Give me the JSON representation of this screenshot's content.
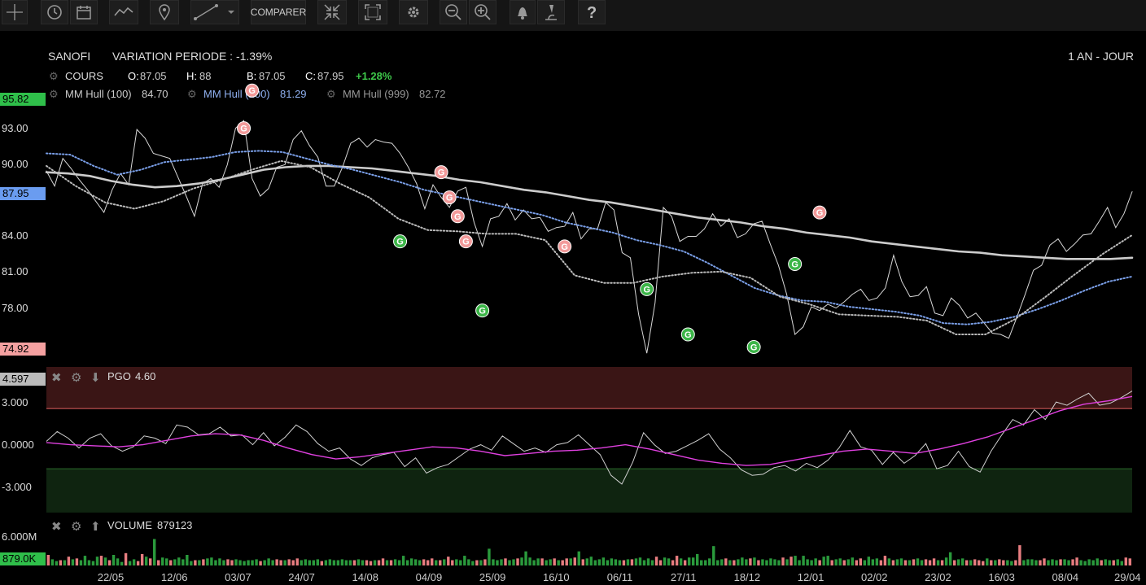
{
  "toolbar": {
    "compare_label": "COMPARER"
  },
  "header": {
    "symbol": "SANOFI",
    "variation_label": "VARIATION PERIODE : -1.39%",
    "period": "1 AN - JOUR"
  },
  "legend": {
    "cours_label": "COURS",
    "o_label": "O:",
    "o_value": "87.05",
    "h_label": "H:",
    "h_value": "88",
    "b_label": "B:",
    "b_value": "87.05",
    "c_label": "C:",
    "c_value": "87.95",
    "change": "+1.28%",
    "hull100": "MM Hull (100)",
    "hull100_value": "84.70",
    "hull200": "MM Hull (200)",
    "hull200_value": "81.29",
    "hull999": "MM Hull (999)",
    "hull999_value": "82.72"
  },
  "pgo_panel": {
    "label": "PGO",
    "value": "4.60",
    "badge": "4.597"
  },
  "volume_panel": {
    "label": "VOLUME",
    "value": "879123",
    "badge": "879.0K",
    "top_tick": "6.000M"
  },
  "price_badges": {
    "high": "95.82",
    "current": "87.95",
    "low": "74.92"
  },
  "colors": {
    "up": "#2db84b",
    "down": "#f08080",
    "hull100": "#cccccc",
    "hull200": "#7a9fe8",
    "hull999": "#999999",
    "pgo_signal": "#e040e0",
    "change": "#3ec94a"
  },
  "chart_data": [
    {
      "type": "line",
      "series": [
        {
          "name": "COURS",
          "values": [
            89.6,
            88.4,
            90.6,
            89.8,
            88.9,
            88.1,
            87.2,
            86.3,
            88.1,
            89.4,
            88.5,
            92.9,
            92.2,
            91.0,
            90.8,
            90.6,
            89.1,
            87.6,
            86.0,
            88.6,
            89.0,
            88.3,
            90.1,
            93.0,
            93.6,
            89.0,
            87.6,
            88.2,
            89.9,
            90.1,
            92.1,
            92.8,
            91.6,
            90.7,
            88.4,
            88.4,
            89.9,
            91.8,
            92.2,
            91.5,
            92.1,
            91.9,
            91.8,
            91.0,
            89.9,
            88.6,
            86.6,
            88.5,
            87.5,
            86.7,
            88.0,
            88.3,
            85.5,
            83.6,
            85.8,
            86.0,
            87.0,
            85.7,
            86.5,
            85.8,
            85.9,
            84.8,
            85.1,
            85.2,
            86.3,
            84.2,
            85.0,
            85.0,
            87.1,
            86.5,
            83.1,
            82.7,
            78.2,
            75.1,
            79.1,
            86.7,
            86.0,
            84.0,
            84.4,
            84.4,
            85.0,
            86.2,
            85.2,
            85.8,
            84.3,
            84.6,
            85.4,
            85.6,
            83.8,
            82.1,
            79.8,
            76.6,
            77.2,
            78.8,
            78.5,
            79.0,
            78.7,
            79.2,
            79.8,
            80.2,
            79.3,
            79.5,
            80.3,
            82.9,
            80.8,
            79.6,
            79.7,
            80.4,
            78.3,
            78.1,
            79.5,
            78.9,
            77.9,
            78.3,
            77.5,
            76.7,
            76.6,
            76.3,
            78.0,
            79.8,
            81.7,
            82.1,
            83.7,
            84.2,
            83.2,
            83.8,
            84.5,
            84.6,
            85.6,
            86.7,
            85.1,
            86.2,
            87.95
          ]
        },
        {
          "name": "MM Hull (100)",
          "values": [
            89.5,
            89.4,
            89.2,
            88.8,
            88.5,
            88.3,
            88.4,
            88.6,
            88.9,
            89.3,
            89.7,
            89.9,
            90.0,
            90.0,
            89.9,
            89.8,
            89.6,
            89.4,
            89.2,
            88.9,
            88.7,
            88.4,
            88.1,
            87.9,
            87.6,
            87.3,
            87.1,
            86.8,
            86.5,
            86.2,
            85.9,
            85.7,
            85.5,
            85.2,
            85.0,
            84.7,
            84.5,
            84.3,
            84.0,
            83.8,
            83.6,
            83.4,
            83.2,
            83.1,
            82.9,
            82.8,
            82.7,
            82.6,
            82.6,
            82.6,
            82.7
          ]
        },
        {
          "name": "MM Hull (200)",
          "values": [
            91.0,
            90.9,
            90.0,
            89.3,
            89.7,
            90.3,
            90.5,
            90.7,
            91.1,
            91.2,
            91.1,
            90.6,
            90.1,
            89.7,
            89.2,
            88.7,
            88.1,
            87.7,
            87.3,
            86.9,
            86.5,
            86.1,
            85.5,
            85.1,
            84.7,
            84.1,
            83.7,
            83.2,
            82.3,
            81.3,
            80.3,
            79.7,
            79.3,
            79.2,
            78.8,
            78.6,
            78.4,
            78.1,
            77.5,
            77.4,
            77.6,
            78.0,
            78.6,
            79.3,
            80.1,
            80.8,
            81.2
          ]
        },
        {
          "name": "MM Hull (999)",
          "values": [
            90.0,
            88.4,
            87.1,
            86.6,
            87.2,
            88.2,
            88.9,
            89.7,
            90.4,
            89.9,
            88.6,
            87.5,
            85.8,
            84.9,
            84.8,
            84.6,
            84.6,
            84.1,
            81.3,
            80.7,
            80.7,
            81.2,
            81.5,
            81.6,
            81.1,
            79.6,
            79.0,
            78.2,
            78.1,
            78.0,
            77.7,
            76.6,
            76.6,
            77.8,
            79.5,
            81.3,
            83.0,
            84.5
          ]
        }
      ],
      "ylim": [
        74.92,
        95.82
      ],
      "y_ticks": [
        "93.00",
        "90.00",
        "84.00",
        "81.00",
        "78.00"
      ]
    },
    {
      "type": "line",
      "series": [
        {
          "name": "PGO",
          "values": [
            0.0,
            0.9,
            0.3,
            -0.6,
            0.3,
            0.7,
            -0.4,
            -0.9,
            -0.5,
            0.5,
            0.3,
            -0.2,
            1.5,
            1.3,
            0.6,
            0.7,
            1.3,
            0.5,
            0.6,
            -0.3,
            0.8,
            -0.4,
            0.4,
            1.5,
            0.9,
            -0.2,
            -0.9,
            -0.6,
            -1.6,
            -2.2,
            -1.5,
            -1.2,
            -1.0,
            -2.3,
            -1.5,
            -2.9,
            -2.4,
            -2.1,
            -1.4,
            -0.7,
            -0.3,
            -0.8,
            0.5,
            -0.2,
            -0.9,
            -0.6,
            -1.0,
            -0.3,
            -0.1,
            0.6,
            -0.3,
            -1.2,
            -3.1,
            -3.9,
            -1.9,
            0.8,
            -0.3,
            -1.1,
            -0.9,
            -0.4,
            0.1,
            0.7,
            -0.7,
            -1.5,
            -2.6,
            -3.1,
            -3.0,
            -2.4,
            -2.2,
            -2.7,
            -2.0,
            -2.4,
            -1.7,
            -0.6,
            1.0,
            -0.5,
            -0.8,
            -2.1,
            -1.0,
            -2.0,
            -1.3,
            -0.2,
            -2.5,
            -2.2,
            -0.9,
            -2.3,
            -2.8,
            -0.9,
            0.6,
            2.0,
            1.5,
            2.9,
            2.0,
            3.6,
            3.3,
            3.9,
            4.4,
            3.3,
            3.5,
            4.0,
            4.6
          ]
        },
        {
          "name": "Signal",
          "values": [
            -0.1,
            -0.3,
            -0.4,
            -0.5,
            -0.3,
            0.1,
            0.5,
            0.7,
            0.6,
            0.1,
            -0.6,
            -1.2,
            -1.6,
            -1.4,
            -1.1,
            -0.8,
            -0.5,
            -0.6,
            -0.9,
            -1.3,
            -1.1,
            -0.9,
            -0.8,
            -0.6,
            -0.3,
            -0.7,
            -1.2,
            -1.7,
            -2.0,
            -2.2,
            -2.1,
            -1.7,
            -1.3,
            -0.9,
            -0.7,
            -0.9,
            -1.1,
            -0.7,
            -0.2,
            0.4,
            1.2,
            2.0,
            2.8,
            3.4,
            3.7,
            4.1
          ]
        }
      ],
      "ylim": [
        -6.5,
        6.8
      ],
      "y_ticks": [
        "3.000",
        "0.0000",
        "-3.000"
      ],
      "overbought": 3.0,
      "oversold": -2.5
    },
    {
      "type": "bar",
      "series": [
        {
          "name": "VOLUME",
          "values": [
            1.2,
            0.7,
            0.5,
            0.6,
            0.6,
            1.0,
            0.7,
            0.8,
            0.6,
            1.1,
            0.6,
            0.5,
            1.0,
            1.1,
            0.9,
            0.6,
            1.2,
            0.8,
            0.4,
            1.4,
            0.5,
            0.7,
            0.5,
            1.3,
            1.0,
            0.8,
            3.0,
            0.6,
            0.9,
            0.8,
            0.6,
            0.7,
            0.9,
            0.7,
            1.2,
            0.5,
            0.6,
            0.6,
            0.7,
            0.8,
            0.9,
            0.6,
            0.8,
            0.6,
            0.7,
            0.6,
            0.7,
            0.6,
            0.5,
            0.6,
            0.6,
            0.7,
            0.5,
            0.6,
            0.8,
            0.6,
            0.7,
            0.6,
            0.6,
            0.7,
            0.6,
            0.8,
            0.6,
            0.7,
            0.6,
            0.6,
            0.7,
            0.5,
            0.6,
            0.7,
            0.6,
            0.6,
            0.7,
            0.6,
            0.6,
            0.6,
            0.7,
            0.6,
            0.6,
            0.5,
            0.6,
            0.6,
            0.8,
            0.6,
            0.6,
            0.7,
            0.6,
            1.1,
            0.6,
            0.8,
            0.7,
            0.6,
            0.7,
            0.6,
            0.8,
            0.6,
            0.6,
            0.7,
            1.0,
            0.6,
            0.7,
            0.6,
            1.1,
            0.7,
            0.5,
            0.6,
            0.6,
            0.7,
            1.9,
            0.7,
            0.6,
            0.7,
            0.8,
            0.6,
            0.7,
            0.8,
            0.9,
            1.6,
            0.9,
            0.6,
            0.8,
            0.8,
            0.6,
            0.7,
            0.8,
            0.6,
            0.6,
            0.8,
            0.8,
            0.9,
            1.6,
            0.7,
            0.8,
            1.0,
            0.6,
            0.7,
            0.9,
            0.6,
            0.8,
            0.7,
            0.6,
            0.6,
            0.7,
            0.7,
            0.8,
            0.9,
            0.6,
            0.8,
            0.6,
            1.0,
            0.6,
            0.9,
            0.8,
            0.6,
            1.1,
            0.8,
            0.6,
            0.9,
            0.9,
            1.3,
            0.6,
            0.6,
            0.8,
            2.2,
            0.6,
            0.7,
            0.8,
            0.6,
            0.6,
            0.7,
            0.9,
            0.7,
            0.8,
            0.9,
            0.6,
            0.7,
            0.6,
            0.8,
            0.7,
            0.6,
            0.9,
            0.7,
            1.0,
            1.1,
            0.6,
            1.1,
            0.7,
            0.6,
            0.8,
            0.6,
            1.0,
            1.1,
            0.6,
            0.7,
            0.8,
            0.6,
            0.7,
            0.9,
            0.6,
            0.8,
            0.6,
            1.0,
            0.7,
            0.8,
            0.6,
            1.1,
            0.8,
            0.6,
            0.7,
            0.8,
            0.6,
            0.6,
            0.7,
            0.8,
            0.6,
            0.7,
            0.6,
            0.8,
            0.6,
            0.6,
            0.9,
            1.5,
            0.6,
            0.7,
            0.8,
            0.6,
            0.6,
            0.7,
            0.6,
            0.5,
            0.8,
            0.6,
            0.6,
            0.7,
            0.6,
            0.6,
            0.5,
            0.6,
            2.3,
            0.6,
            0.7,
            0.7,
            0.6,
            0.6,
            0.8,
            0.6,
            0.7,
            0.6,
            0.7,
            0.7,
            0.6,
            0.7,
            0.9,
            0.6,
            0.5,
            0.7,
            0.6,
            0.8,
            0.6,
            0.7,
            0.6,
            0.6,
            0.7,
            0.5,
            0.9,
            0.8
          ]
        }
      ],
      "ylim": [
        0,
        6.0
      ],
      "y_ticks": [
        "6.000M"
      ]
    }
  ],
  "x_axis_labels": [
    "22/05",
    "12/06",
    "03/07",
    "24/07",
    "14/08",
    "04/09",
    "25/09",
    "16/10",
    "06/11",
    "27/11",
    "18/12",
    "12/01",
    "02/02",
    "23/02",
    "16/03",
    "08/04",
    "29/04"
  ],
  "signal_markers": [
    {
      "label": "G",
      "kind": "sell",
      "x_index": 24,
      "y": 93.0
    },
    {
      "label": "G",
      "kind": "sell",
      "x_index": 25,
      "y": 96.0
    },
    {
      "label": "G",
      "kind": "buy",
      "x_index": 43,
      "y": 84.0
    },
    {
      "label": "G",
      "kind": "sell",
      "x_index": 48,
      "y": 89.5
    },
    {
      "label": "G",
      "kind": "sell",
      "x_index": 49,
      "y": 87.5
    },
    {
      "label": "G",
      "kind": "sell",
      "x_index": 50,
      "y": 86.0
    },
    {
      "label": "G",
      "kind": "sell",
      "x_index": 51,
      "y": 84.0
    },
    {
      "label": "G",
      "kind": "buy",
      "x_index": 53,
      "y": 78.5
    },
    {
      "label": "G",
      "kind": "sell",
      "x_index": 63,
      "y": 83.6
    },
    {
      "label": "G",
      "kind": "buy",
      "x_index": 73,
      "y": 80.2
    },
    {
      "label": "G",
      "kind": "buy",
      "x_index": 78,
      "y": 76.6
    },
    {
      "label": "G",
      "kind": "buy",
      "x_index": 86,
      "y": 75.6
    },
    {
      "label": "G",
      "kind": "buy",
      "x_index": 91,
      "y": 82.2
    },
    {
      "label": "G",
      "kind": "sell",
      "x_index": 94,
      "y": 86.3
    }
  ]
}
